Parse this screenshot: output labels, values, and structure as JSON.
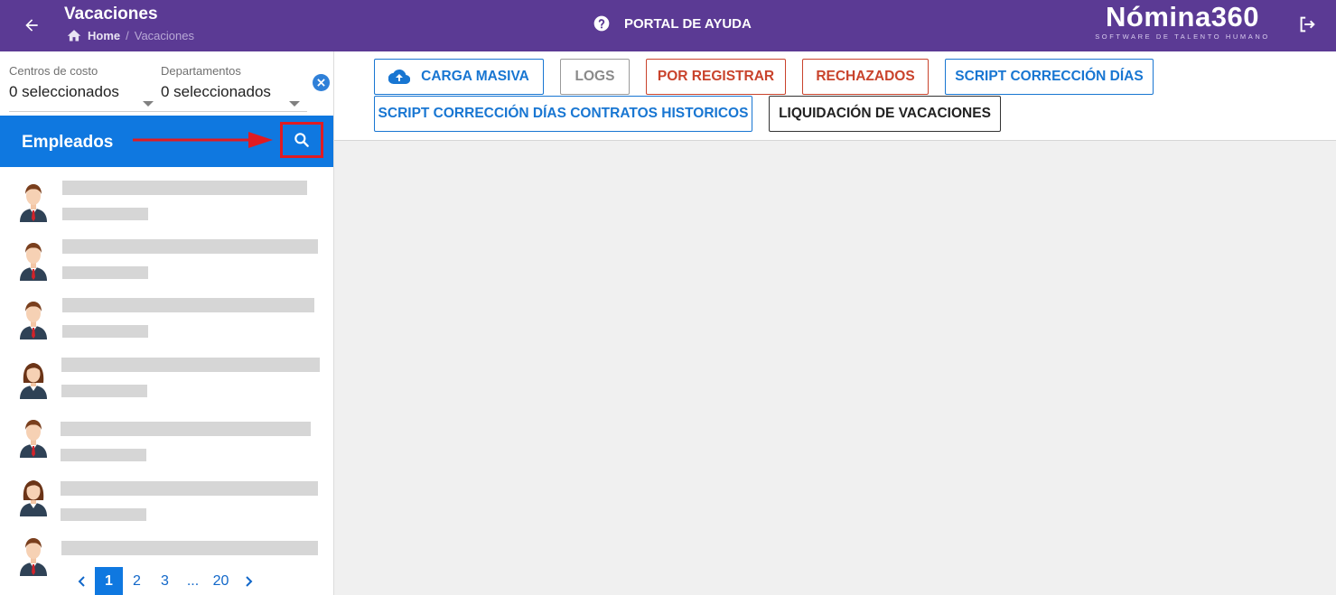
{
  "header": {
    "title": "Vacaciones",
    "breadcrumb": {
      "home": "Home",
      "separator": "/",
      "current": "Vacaciones"
    },
    "help_label": "PORTAL DE AYUDA",
    "logo_name": "Nómina360",
    "logo_tagline": "SOFTWARE DE TALENTO HUMANO",
    "colors": {
      "bar": "#5b3a94"
    }
  },
  "filters": {
    "cost_centers": {
      "label": "Centros de costo",
      "value": "0 seleccionados"
    },
    "departments": {
      "label": "Departamentos",
      "value": "0 seleccionados"
    }
  },
  "employees": {
    "title": "Empleados",
    "colors": {
      "header": "#0f78e0",
      "highlight": "#e01b22"
    },
    "avatars": [
      "male",
      "male",
      "male",
      "female",
      "male",
      "female",
      "male"
    ]
  },
  "pagination": {
    "pages": [
      "1",
      "2",
      "3",
      "...",
      "20"
    ],
    "current": "1"
  },
  "toolbar": {
    "carga_masiva": "CARGA MASIVA",
    "logs": "LOGS",
    "por_registrar": "POR REGISTRAR",
    "rechazados": "RECHAZADOS",
    "script_correccion": "SCRIPT CORRECCIÓN DÍAS",
    "script_historicos": "SCRIPT CORRECCIÓN DÍAS CONTRATOS HISTORICOS",
    "liquidacion": "LIQUIDACIÓN DE VACACIONES"
  }
}
